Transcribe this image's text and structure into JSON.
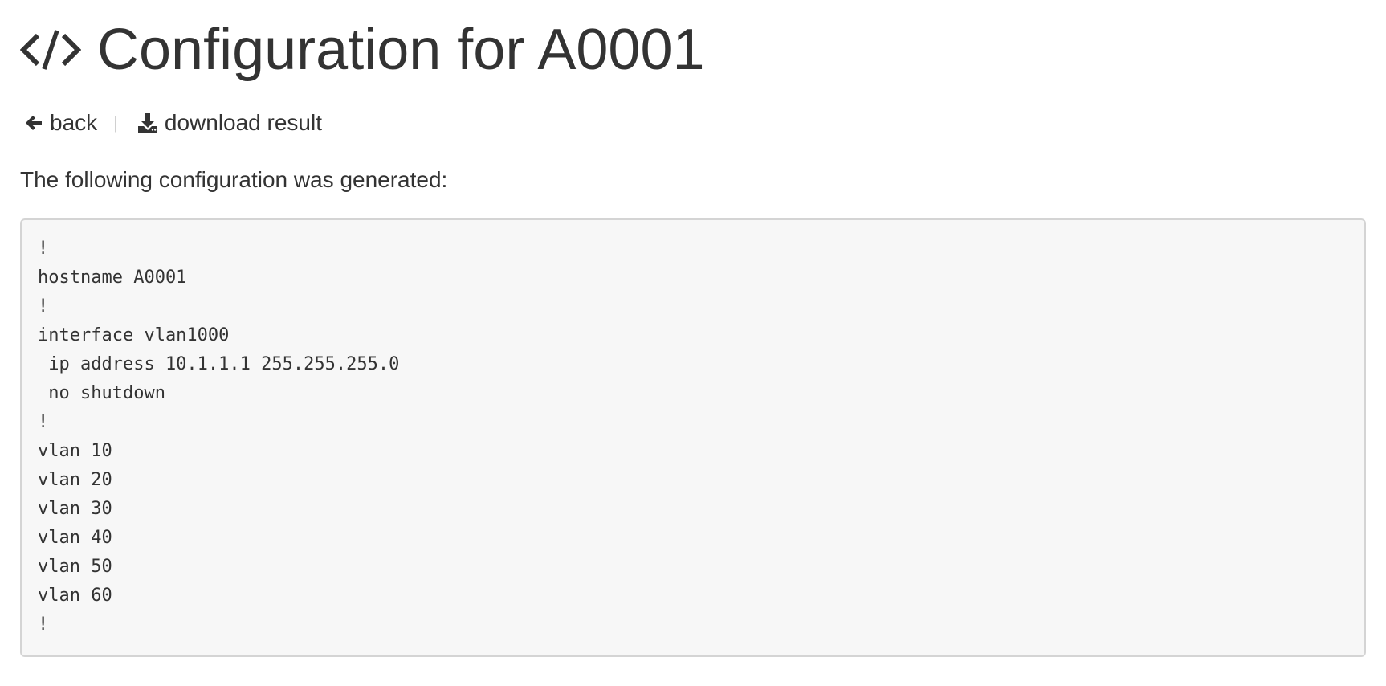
{
  "header": {
    "title": "Configuration for A0001",
    "icon": "code-icon"
  },
  "actions": {
    "back": {
      "label": "back",
      "icon": "arrow-left-icon"
    },
    "download": {
      "label": "download result",
      "icon": "download-icon"
    }
  },
  "intro_text": "The following configuration was generated:",
  "config_lines": [
    "!",
    "hostname A0001",
    "!",
    "interface vlan1000",
    " ip address 10.1.1.1 255.255.255.0",
    " no shutdown",
    "!",
    "vlan 10",
    "vlan 20",
    "vlan 30",
    "vlan 40",
    "vlan 50",
    "vlan 60",
    "!"
  ],
  "colors": {
    "text": "#333333",
    "code_background": "#f7f7f7",
    "code_border": "#d4d4d4",
    "separator": "#cccccc"
  }
}
